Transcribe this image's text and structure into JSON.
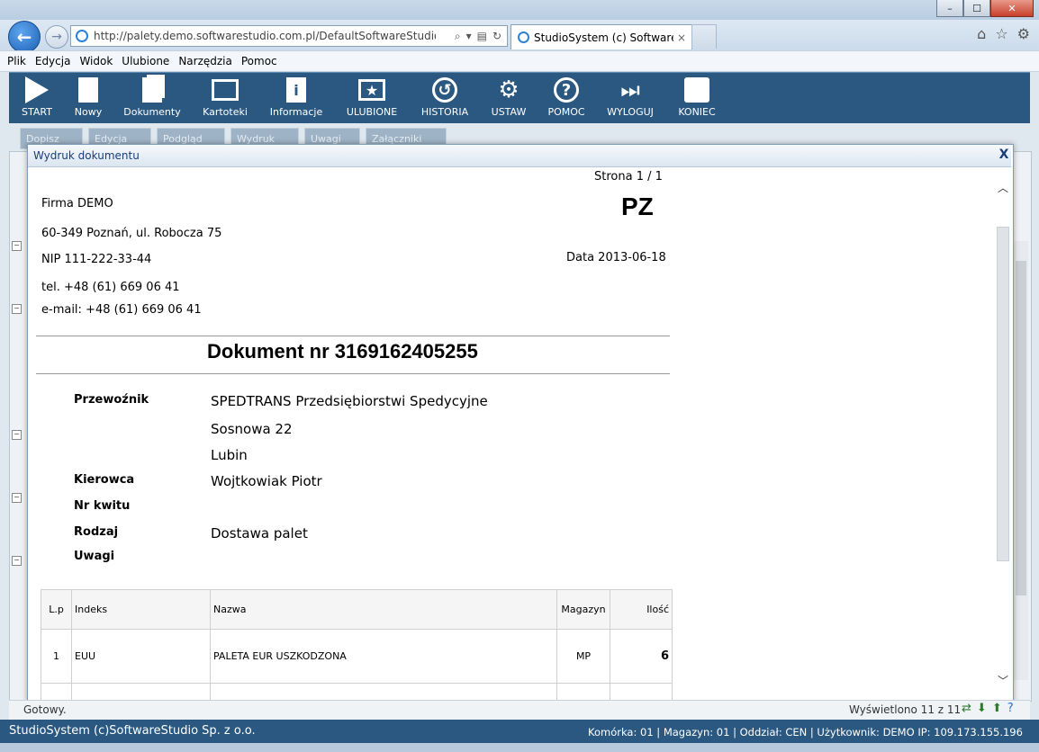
{
  "browser": {
    "window_controls": [
      "–",
      "☐",
      "✕"
    ],
    "address_url": "http://palety.demo.softwarestudio.com.pl/DefaultSoftwareStudio.aspx?rol",
    "tab_title": "StudioSystem (c) SoftwareS...",
    "tab_close": "×",
    "menu": [
      "Plik",
      "Edycja",
      "Widok",
      "Ulubione",
      "Narzędzia",
      "Pomoc"
    ]
  },
  "toolbar": [
    {
      "label": "START",
      "icon": "play-icon"
    },
    {
      "label": "Nowy",
      "icon": "new-document-icon"
    },
    {
      "label": "Dokumenty",
      "icon": "documents-icon"
    },
    {
      "label": "Kartoteki",
      "icon": "monitor-icon"
    },
    {
      "label": "Informacje",
      "icon": "info-document-icon"
    },
    {
      "label": "ULUBIONE",
      "icon": "star-icon"
    },
    {
      "label": "HISTORIA",
      "icon": "history-icon"
    },
    {
      "label": "USTAW",
      "icon": "gear-icon"
    },
    {
      "label": "POMOC",
      "icon": "help-icon"
    },
    {
      "label": "WYLOGUJ",
      "icon": "logout-icon"
    },
    {
      "label": "KONIEC",
      "icon": "stop-icon"
    }
  ],
  "subtoolbar": [
    "Dopisz",
    "Edycja",
    "Podgląd",
    "Wydruk",
    "Uwagi",
    "Załączniki"
  ],
  "modal": {
    "title": "Wydruk dokumentu",
    "close": "X"
  },
  "document": {
    "page": "Strona 1 / 1",
    "company_name": "Firma DEMO",
    "doc_type": "PZ",
    "address": "60-349 Poznań, ul. Robocza 75",
    "nip": "NIP 111-222-33-44",
    "date": "Data 2013-06-18",
    "phone": "tel. +48 (61) 669 06 41",
    "email": "e-mail: +48 (61) 669 06 41",
    "doc_number": "Dokument nr 3169162405255",
    "fields": {
      "carrier_label": "Przewoźnik",
      "carrier_name": "SPEDTRANS Przedsiębiorstwi Spedycyjne",
      "carrier_street": "Sosnowa 22",
      "carrier_city": "Lubin",
      "driver_label": "Kierowca",
      "driver_value": "Wojtkowiak Piotr",
      "receipt_label": "Nr kwitu",
      "type_label": "Rodzaj",
      "type_value": "Dostawa palet",
      "notes_label": "Uwagi"
    },
    "table": {
      "headers": [
        "L.p",
        "Indeks",
        "Nazwa",
        "Magazyn",
        "Ilość"
      ],
      "rows": [
        {
          "lp": "1",
          "index": "EUU",
          "name": "PALETA EUR USZKODZONA",
          "warehouse": "MP",
          "qty": "6"
        }
      ]
    }
  },
  "status": {
    "left": "Gotowy.",
    "right": "Wyświetlono 11 z 11"
  },
  "footer": {
    "left": "StudioSystem (c)SoftwareStudio Sp. z o.o.",
    "right": "Komórka: 01 | Magazyn: 01 | Oddział: CEN | Użytkownik: DEMO IP: 109.173.155.196"
  }
}
